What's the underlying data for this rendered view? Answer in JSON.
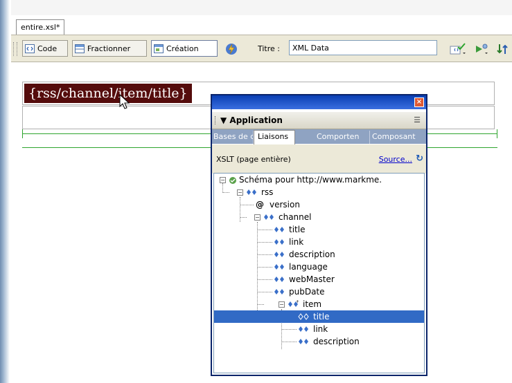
{
  "document": {
    "tab_label": "entire.xsl*"
  },
  "toolbar": {
    "code_label": "Code",
    "split_label": "Fractionner",
    "design_label": "Création",
    "title_label": "Titre :",
    "title_value": "XML Data",
    "icons": [
      "code-view-icon",
      "split-view-icon",
      "design-view-icon",
      "live-data-icon",
      "validate-icon",
      "preview-icon",
      "file-management-icon"
    ]
  },
  "design": {
    "xsl_expression": "{rss/channel/item/title}"
  },
  "panel": {
    "title": "Application",
    "tabs": [
      {
        "label": "Bases de do"
      },
      {
        "label": "Liaisons"
      },
      {
        "label": "Comporten"
      },
      {
        "label": "Composant"
      }
    ],
    "active_tab": "Liaisons",
    "source_type": "XSLT (page entière)",
    "source_link": "Source...",
    "tree": [
      {
        "label": "Schéma pour http://www.markme."
      },
      {
        "label": "rss"
      },
      {
        "label": "version"
      },
      {
        "label": "channel"
      },
      {
        "label": "title"
      },
      {
        "label": "link"
      },
      {
        "label": "description"
      },
      {
        "label": "language"
      },
      {
        "label": "webMaster"
      },
      {
        "label": "pubDate"
      },
      {
        "label": "item"
      },
      {
        "label": "title"
      },
      {
        "label": "link"
      },
      {
        "label": "description"
      }
    ],
    "selected_node": "title"
  },
  "colors": {
    "accent": "#316ac5",
    "xsl_bg": "#550c0c",
    "panel_title": "#0a3fb3",
    "ruler": "#2da42d"
  }
}
